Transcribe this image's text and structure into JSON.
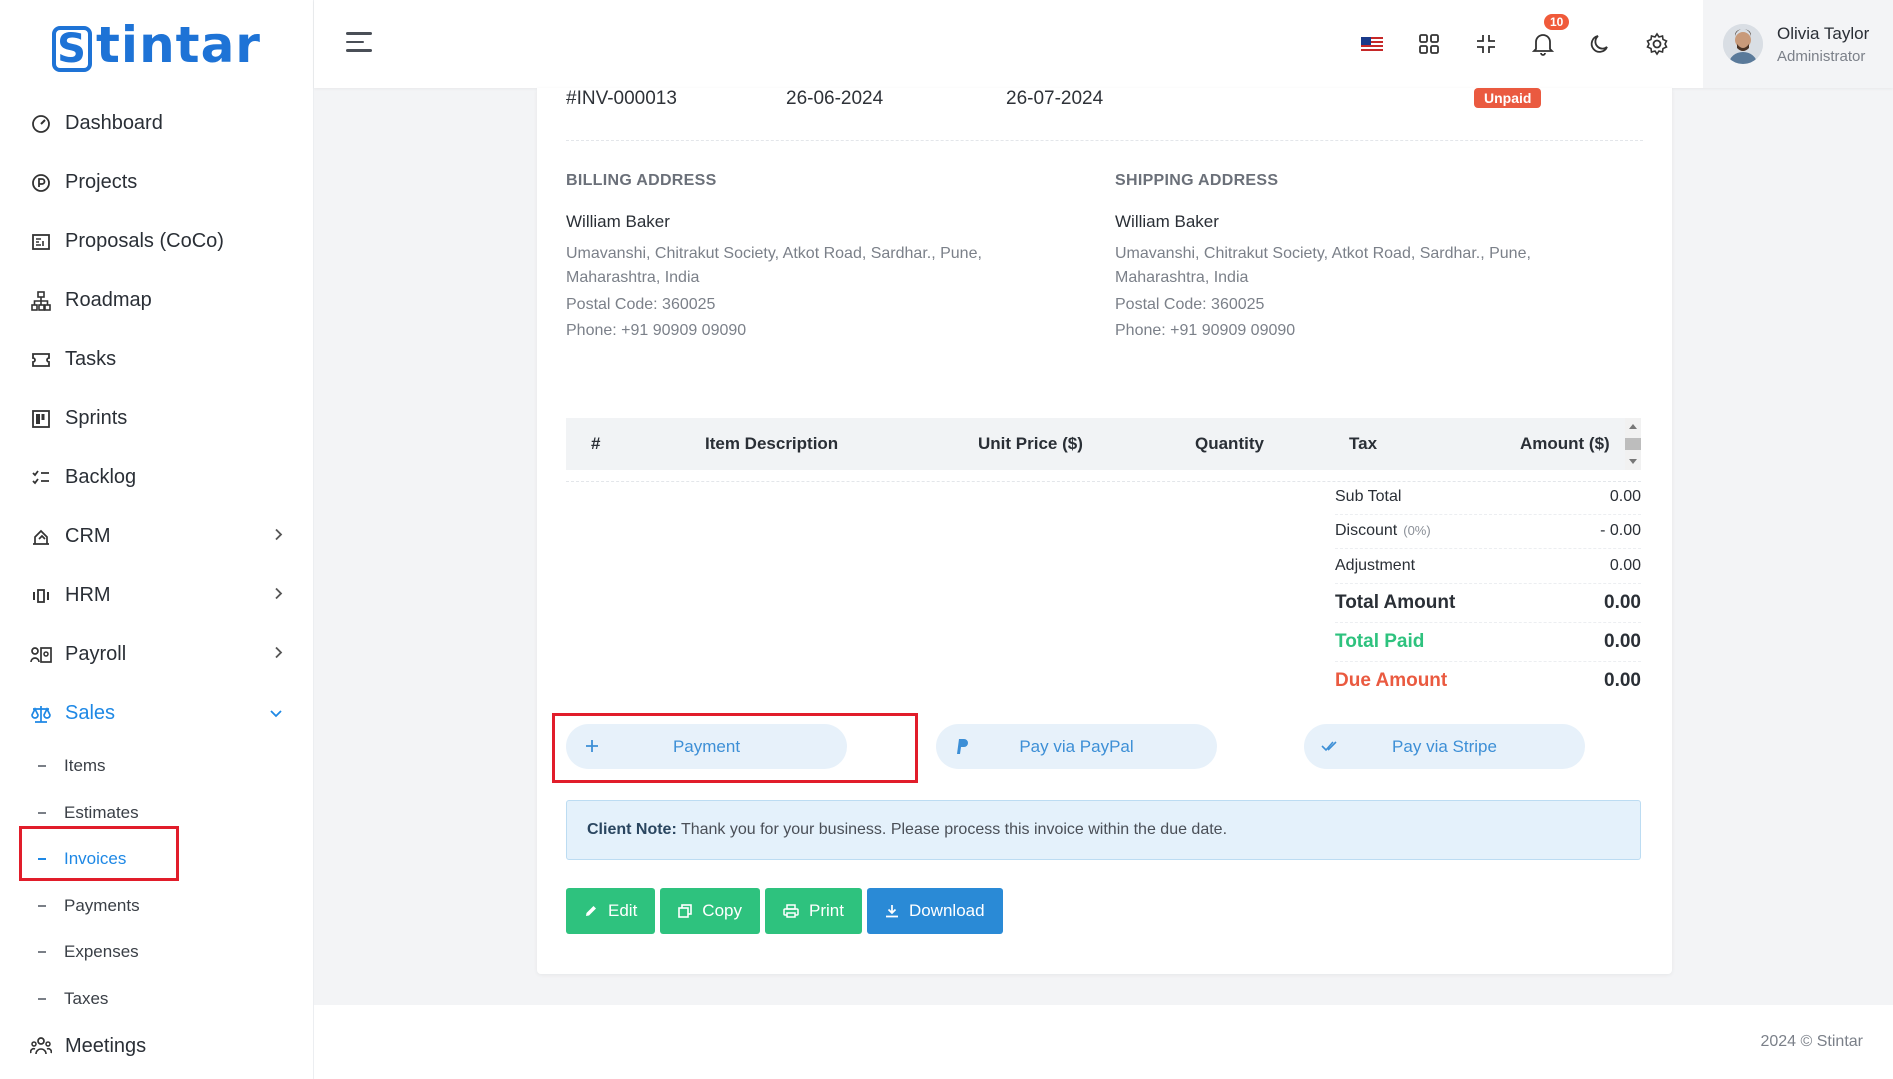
{
  "brand": {
    "name": "Stintar",
    "accent": "#1e73d6"
  },
  "sidebar": {
    "items": [
      {
        "label": "Dashboard",
        "icon": "gauge-icon"
      },
      {
        "label": "Projects",
        "icon": "p-circle-icon"
      },
      {
        "label": "Proposals (CoCo)",
        "icon": "document-icon"
      },
      {
        "label": "Roadmap",
        "icon": "sitemap-icon"
      },
      {
        "label": "Tasks",
        "icon": "ticket-icon"
      },
      {
        "label": "Sprints",
        "icon": "board-icon"
      },
      {
        "label": "Backlog",
        "icon": "checklist-icon"
      },
      {
        "label": "CRM",
        "icon": "handshake-icon"
      },
      {
        "label": "HRM",
        "icon": "users-icon"
      },
      {
        "label": "Payroll",
        "icon": "id-card-icon"
      },
      {
        "label": "Sales",
        "icon": "scale-icon"
      }
    ],
    "sales_sub": [
      "Items",
      "Estimates",
      "Invoices",
      "Payments",
      "Expenses",
      "Taxes"
    ],
    "meetings": "Meetings"
  },
  "header": {
    "notifications_count": "10",
    "user_name": "Olivia Taylor",
    "user_role": "Administrator"
  },
  "invoice": {
    "number": "#INV-000013",
    "date": "26-06-2024",
    "due_date": "26-07-2024",
    "status": "Unpaid",
    "billing": {
      "title": "BILLING ADDRESS",
      "name": "William Baker",
      "address": "Umavanshi, Chitrakut Society, Atkot Road, Sardhar., Pune, Maharashtra, India",
      "postal": "Postal Code: 360025",
      "phone": "Phone: +91 90909 09090"
    },
    "shipping": {
      "title": "SHIPPING ADDRESS",
      "name": "William Baker",
      "address": "Umavanshi, Chitrakut Society, Atkot Road, Sardhar., Pune, Maharashtra, India",
      "postal": "Postal Code: 360025",
      "phone": "Phone: +91 90909 09090"
    },
    "columns": [
      "#",
      "Item Description",
      "Unit Price ($)",
      "Quantity",
      "Tax",
      "Amount ($)"
    ],
    "totals": {
      "sub_total_label": "Sub Total",
      "sub_total": "0.00",
      "discount_label": "Discount",
      "discount_pct": "(0%)",
      "discount": "- 0.00",
      "adjustment_label": "Adjustment",
      "adjustment": "0.00",
      "total_label": "Total Amount",
      "total": "0.00",
      "paid_label": "Total Paid",
      "paid": "0.00",
      "due_label": "Due Amount",
      "due": "0.00"
    },
    "pay_buttons": {
      "payment": "Payment",
      "paypal": "Pay via PayPal",
      "stripe": "Pay via Stripe"
    },
    "note_label": "Client Note:",
    "note_text": "Thank you for your business. Please process this invoice within the due date.",
    "actions": {
      "edit": "Edit",
      "copy": "Copy",
      "print": "Print",
      "download": "Download"
    }
  },
  "footer": {
    "text": "2024 © Stintar"
  }
}
